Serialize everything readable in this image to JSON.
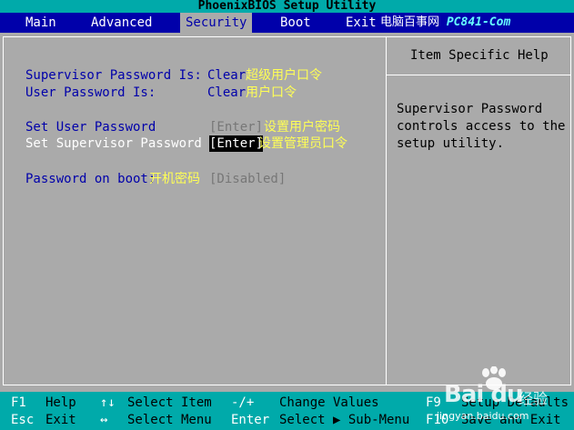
{
  "window": {
    "title": "PhoenixBIOS Setup Utility"
  },
  "menu": {
    "items": [
      {
        "label": "Main",
        "active": false
      },
      {
        "label": "Advanced",
        "active": false
      },
      {
        "label": "Security",
        "active": true
      },
      {
        "label": "Boot",
        "active": false
      },
      {
        "label": "Exit",
        "active": false
      }
    ],
    "watermark_cn": "电脑百事网",
    "watermark_brand": "PC841-Com"
  },
  "security": {
    "supervisor_status_label": "Supervisor Password Is:",
    "supervisor_status_value": "Clear",
    "supervisor_status_note": "超级用户口令",
    "user_status_label": "User Password Is:",
    "user_status_value": "Clear",
    "user_status_note": "用户口令",
    "set_user_label": "Set User Password",
    "set_user_value": "[Enter]",
    "set_user_note": "设置用户密码",
    "set_supervisor_label": "Set Supervisor Password",
    "set_supervisor_value": "[Enter]",
    "set_supervisor_note": "设置管理员口令",
    "password_on_boot_label": "Password on boot:",
    "password_on_boot_note": "开机密码",
    "password_on_boot_value": "[Disabled]"
  },
  "help": {
    "title": "Item Specific Help",
    "text": "Supervisor Password\ncontrols access to the\nsetup utility."
  },
  "footer": {
    "row1": [
      {
        "key": "F1",
        "action": "Help"
      },
      {
        "key": "↑↓",
        "action": "Select Item"
      },
      {
        "key": "-/+",
        "action": "Change Values"
      },
      {
        "key": "F9",
        "action": "Setup Defaults"
      }
    ],
    "row2": [
      {
        "key": "Esc",
        "action": "Exit"
      },
      {
        "key": "↔",
        "action": "Select Menu"
      },
      {
        "key": "Enter",
        "action": "Select ▶ Sub-Menu"
      },
      {
        "key": "F10",
        "action": "Save and Exit"
      }
    ]
  },
  "watermark": {
    "logo": "Bai du",
    "cn": "经验",
    "url": "jingyan.baidu.com"
  },
  "colors": {
    "menu_bg": "#0000aa",
    "bios_gray": "#aaaaaa",
    "title_cyan": "#00aaaa",
    "label_blue": "#0000aa",
    "note_yellow": "#ffff55"
  }
}
